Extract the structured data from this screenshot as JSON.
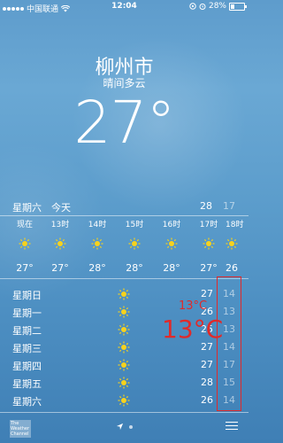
{
  "status_bar": {
    "carrier": "中国联通",
    "time": "12:04",
    "battery": "28%",
    "battery_level": 0.28
  },
  "location": {
    "city": "柳州市",
    "condition": "晴间多云",
    "current_temp": "27°"
  },
  "today": {
    "day": "星期六",
    "label": "今天",
    "high": "28",
    "low": "17"
  },
  "hourly": [
    {
      "time": "现在",
      "icon": "sun-icon",
      "temp": "27°"
    },
    {
      "time": "13时",
      "icon": "sun-icon",
      "temp": "27°"
    },
    {
      "time": "14时",
      "icon": "sun-icon",
      "temp": "28°"
    },
    {
      "time": "15时",
      "icon": "sun-icon",
      "temp": "28°"
    },
    {
      "time": "16时",
      "icon": "sun-icon",
      "temp": "28°"
    },
    {
      "time": "17时",
      "icon": "sun-icon",
      "temp": "27°"
    },
    {
      "time": "18时",
      "icon": "sun-icon",
      "temp": "26"
    }
  ],
  "daily": [
    {
      "day": "星期日",
      "icon": "sun-icon",
      "high": "27",
      "low": "14"
    },
    {
      "day": "星期一",
      "icon": "sun-icon",
      "high": "26",
      "low": "13"
    },
    {
      "day": "星期二",
      "icon": "sun-icon",
      "high": "25",
      "low": "13"
    },
    {
      "day": "星期三",
      "icon": "sun-icon",
      "high": "27",
      "low": "14"
    },
    {
      "day": "星期四",
      "icon": "sun-icon",
      "high": "27",
      "low": "17"
    },
    {
      "day": "星期五",
      "icon": "sun-icon",
      "high": "28",
      "low": "15"
    },
    {
      "day": "星期六",
      "icon": "sun-icon",
      "high": "26",
      "low": "14"
    }
  ],
  "annotations": {
    "small": "13°C",
    "big": "13°C",
    "color": "#e02a2a"
  },
  "bottom_bar": {
    "logo_text": "The Weather Channel"
  }
}
